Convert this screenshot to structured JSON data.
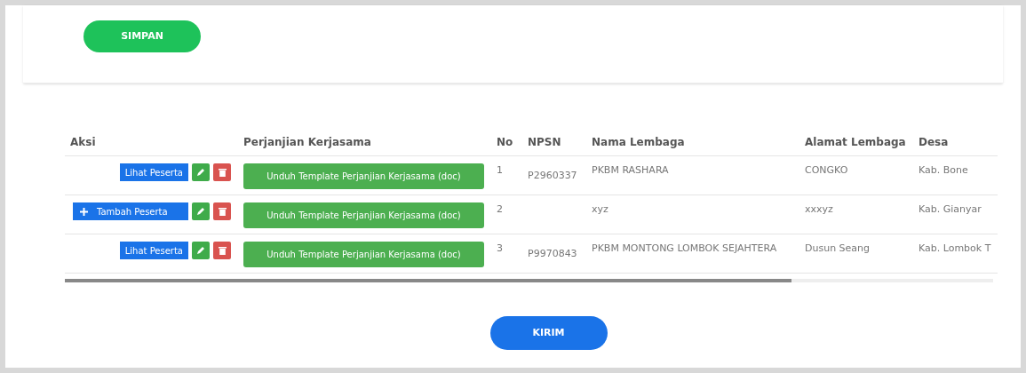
{
  "save_button": "SIMPAN",
  "table": {
    "columns": [
      "Aksi",
      "Perjanjian Kerjasama",
      "No",
      "NPSN",
      "Nama Lembaga",
      "Alamat Lembaga",
      "Desa"
    ],
    "rows": [
      {
        "action": {
          "kind": "view",
          "label": "Lihat Peserta"
        },
        "agreement": "Unduh Template Perjanjian Kerjasama (doc)",
        "no": "1",
        "npsn": "P2960337",
        "name": "PKBM RASHARA",
        "address": "CONGKO",
        "village": "Kab. Bone"
      },
      {
        "action": {
          "kind": "add",
          "label": "Tambah Peserta"
        },
        "agreement": "Unduh Template Perjanjian Kerjasama (doc)",
        "no": "2",
        "npsn": "",
        "name": "xyz",
        "address": "xxxyz",
        "village": "Kab. Gianyar"
      },
      {
        "action": {
          "kind": "view",
          "label": "Lihat Peserta"
        },
        "agreement": "Unduh Template Perjanjian Kerjasama (doc)",
        "no": "3",
        "npsn": "P9970843",
        "name": "PKBM MONTONG LOMBOK SEJAHTERA",
        "address": "Dusun Seang",
        "village": "Kab. Lombok T"
      }
    ]
  },
  "submit_button": "KIRIM"
}
